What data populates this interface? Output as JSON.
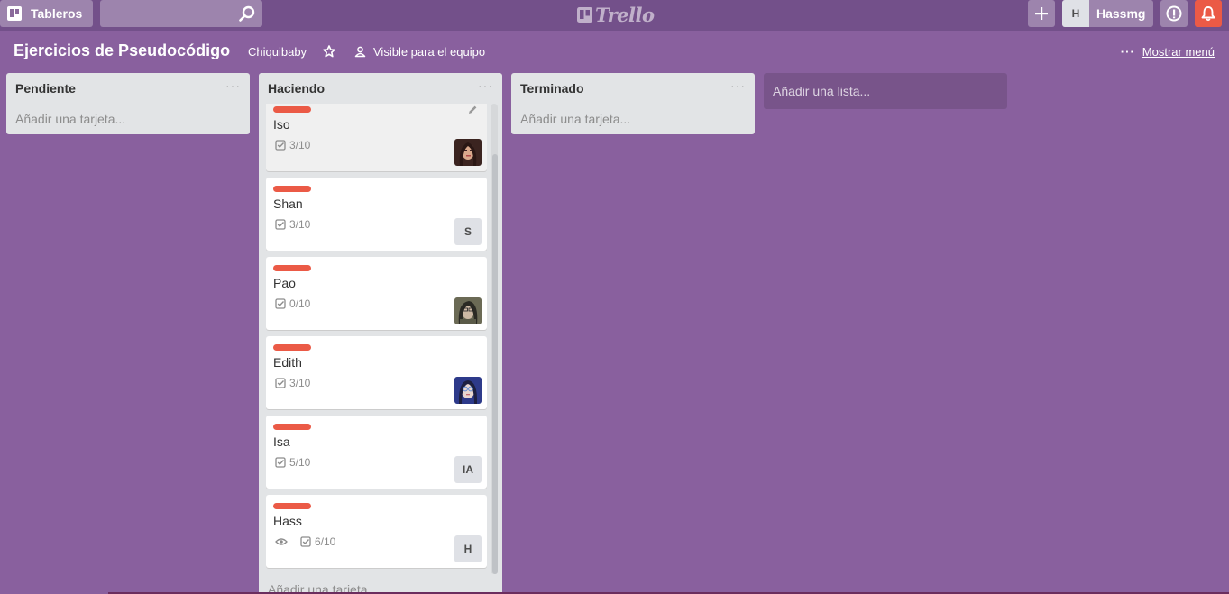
{
  "header": {
    "boards_label": "Tableros",
    "search_placeholder": "",
    "logo_text": "Trello",
    "user_initial": "H",
    "user_name": "Hassmg"
  },
  "board": {
    "title": "Ejercicios de Pseudocódigo",
    "team": "Chiquibaby",
    "visibility": "Visible para el equipo",
    "menu_label": "Mostrar menú"
  },
  "lists": [
    {
      "title": "Pendiente",
      "add_card": "Añadir una tarjeta..."
    },
    {
      "title": "Haciendo",
      "add_card": "Añadir una tarjeta...",
      "cards": [
        {
          "title": "Iso",
          "checklist": "3/10",
          "member": "photo"
        },
        {
          "title": "Shan",
          "checklist": "3/10",
          "member": "S"
        },
        {
          "title": "Pao",
          "checklist": "0/10",
          "member": "photo"
        },
        {
          "title": "Edith",
          "checklist": "3/10",
          "member": "photo"
        },
        {
          "title": "Isa",
          "checklist": "5/10",
          "member": "IA"
        },
        {
          "title": "Hass",
          "checklist": "6/10",
          "member": "H",
          "watching": true
        }
      ]
    },
    {
      "title": "Terminado",
      "add_card": "Añadir una tarjeta..."
    }
  ],
  "add_list": "Añadir una lista...",
  "colors": {
    "board_bg": "#89609e",
    "header_bg": "#73508a",
    "label_red": "#eb5a46",
    "notification": "#eb5a46"
  }
}
